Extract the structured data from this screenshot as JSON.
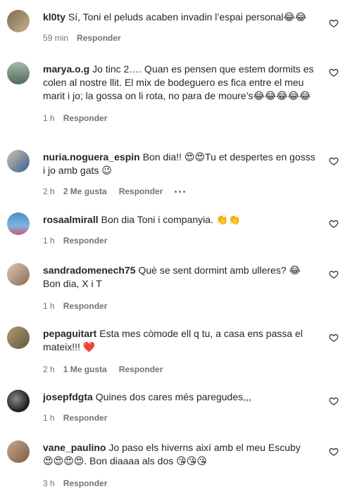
{
  "comments": [
    {
      "user": "kl0ty",
      "text": "Sí, Toni el peluds acaben invadin l’espai personal😂😂",
      "time": "59 min",
      "likes": "",
      "reply": "Responder",
      "avatar_colors": [
        "#7a6b54",
        "#c9b18a"
      ]
    },
    {
      "user": "marya.o.g",
      "text": "Jo tinc 2…. Quan es pensen que estem dormits es colen al nostre llit. El mix de bodeguero es fica entre el meu marit i jo; la gossa on li rota, no para de moure’s😂😂😂😂😂",
      "time": "1 h",
      "likes": "",
      "reply": "Responder",
      "avatar_colors": [
        "#4f6a5a",
        "#a8b8a8"
      ]
    },
    {
      "user": "nuria.noguera_espin",
      "text": "Bon dia!! 😍😍Tu et despertes en gosss i jo amb gats 😉",
      "time": "2 h",
      "likes": "2 Me gusta",
      "reply": "Responder",
      "more": true,
      "avatar_colors": [
        "#2f5f9a",
        "#d7c3a6"
      ]
    },
    {
      "user": "rosaalmirall",
      "text": "Bon dia Toni i companyia. 👏👏",
      "time": "1 h",
      "likes": "",
      "reply": "Responder",
      "avatar_colors": [
        "#4a8fc4",
        "#c65a7a"
      ]
    },
    {
      "user": "sandradomenech75",
      "text": "Què se sent dormint amb ulleres? 😂 Bon dia, X i T",
      "time": "1 h",
      "likes": "",
      "reply": "Responder",
      "avatar_colors": [
        "#d9c7b3",
        "#8a6a55"
      ]
    },
    {
      "user": "pepaguitart",
      "text": "Esta mes còmode ell q tu, a casa ens passa el mateix!!! ❤️",
      "time": "2 h",
      "likes": "1 Me gusta",
      "reply": "Responder",
      "avatar_colors": [
        "#5c5a3e",
        "#b59a70"
      ]
    },
    {
      "user": "josepfdgta",
      "text": "Quines dos cares més paregudes,,,",
      "time": "1 h",
      "likes": "",
      "reply": "Responder",
      "avatar_colors": [
        "#1a1a1a",
        "#8a8a8a"
      ]
    },
    {
      "user": "vane_paulino",
      "text": "Jo paso els hiverns així amb el meu Escuby 😍😍😍😍. Bon diaaaa als dos 😘😘😘",
      "time": "3 h",
      "likes": "",
      "reply": "Responder",
      "avatar_colors": [
        "#c9a98e",
        "#7d5a44"
      ]
    }
  ]
}
